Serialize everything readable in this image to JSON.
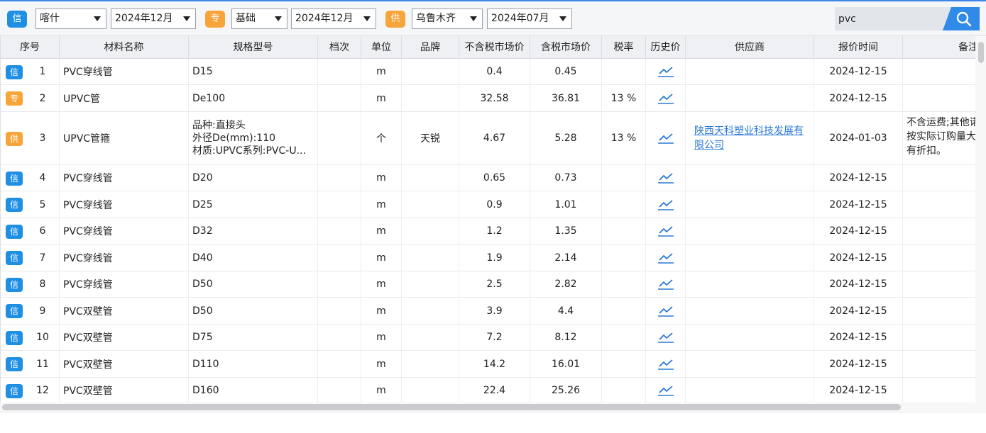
{
  "filters": [
    {
      "badge": "信",
      "badge_color": "#1f8fe3",
      "region": "喀什",
      "date": "2024年12月"
    },
    {
      "badge": "专",
      "badge_color": "#f7a43a",
      "region": "基础",
      "date": "2024年12月"
    },
    {
      "badge": "供",
      "badge_color": "#f7a43a",
      "region": "乌鲁木齐",
      "date": "2024年07月"
    }
  ],
  "search": {
    "value": "pvc"
  },
  "table": {
    "headers": [
      "序号",
      "材料名称",
      "规格型号",
      "档次",
      "单位",
      "品牌",
      "不含税市场价",
      "含税市场价",
      "税率",
      "历史价",
      "供应商",
      "报价时间",
      "备注"
    ],
    "rows": [
      {
        "badge": "信",
        "seq": "1",
        "name": "PVC穿线管",
        "spec": [
          "D15"
        ],
        "grade": "",
        "unit": "m",
        "brand": "",
        "price_ex": "0.4",
        "price_in": "0.45",
        "tax": "",
        "supplier": "",
        "date": "2024-12-15",
        "remark": ""
      },
      {
        "badge": "专",
        "seq": "2",
        "name": "UPVC管",
        "spec": [
          "De100"
        ],
        "grade": "",
        "unit": "m",
        "brand": "",
        "price_ex": "32.58",
        "price_in": "36.81",
        "tax": "13 %",
        "supplier": "",
        "date": "2024-12-15",
        "remark": ""
      },
      {
        "badge": "供",
        "seq": "3",
        "name": "UPVC管箍",
        "spec": [
          "品种:直接头",
          "外径De(mm):110",
          "材质:UPVC系列:PVC-U..."
        ],
        "grade": "",
        "unit": "个",
        "brand": "天锐",
        "price_ex": "4.67",
        "price_in": "5.28",
        "tax": "13 %",
        "supplier": "陕西天科塑业科技发展有限公司",
        "date": "2024-01-03",
        "remark": "不含运费;其他诺体按实际订购量大享有折扣。"
      },
      {
        "badge": "信",
        "seq": "4",
        "name": "PVC穿线管",
        "spec": [
          "D20"
        ],
        "grade": "",
        "unit": "m",
        "brand": "",
        "price_ex": "0.65",
        "price_in": "0.73",
        "tax": "",
        "supplier": "",
        "date": "2024-12-15",
        "remark": ""
      },
      {
        "badge": "信",
        "seq": "5",
        "name": "PVC穿线管",
        "spec": [
          "D25"
        ],
        "grade": "",
        "unit": "m",
        "brand": "",
        "price_ex": "0.9",
        "price_in": "1.01",
        "tax": "",
        "supplier": "",
        "date": "2024-12-15",
        "remark": ""
      },
      {
        "badge": "信",
        "seq": "6",
        "name": "PVC穿线管",
        "spec": [
          "D32"
        ],
        "grade": "",
        "unit": "m",
        "brand": "",
        "price_ex": "1.2",
        "price_in": "1.35",
        "tax": "",
        "supplier": "",
        "date": "2024-12-15",
        "remark": ""
      },
      {
        "badge": "信",
        "seq": "7",
        "name": "PVC穿线管",
        "spec": [
          "D40"
        ],
        "grade": "",
        "unit": "m",
        "brand": "",
        "price_ex": "1.9",
        "price_in": "2.14",
        "tax": "",
        "supplier": "",
        "date": "2024-12-15",
        "remark": ""
      },
      {
        "badge": "信",
        "seq": "8",
        "name": "PVC穿线管",
        "spec": [
          "D50"
        ],
        "grade": "",
        "unit": "m",
        "brand": "",
        "price_ex": "2.5",
        "price_in": "2.82",
        "tax": "",
        "supplier": "",
        "date": "2024-12-15",
        "remark": ""
      },
      {
        "badge": "信",
        "seq": "9",
        "name": "PVC双壁管",
        "spec": [
          "D50"
        ],
        "grade": "",
        "unit": "m",
        "brand": "",
        "price_ex": "3.9",
        "price_in": "4.4",
        "tax": "",
        "supplier": "",
        "date": "2024-12-15",
        "remark": ""
      },
      {
        "badge": "信",
        "seq": "10",
        "name": "PVC双壁管",
        "spec": [
          "D75"
        ],
        "grade": "",
        "unit": "m",
        "brand": "",
        "price_ex": "7.2",
        "price_in": "8.12",
        "tax": "",
        "supplier": "",
        "date": "2024-12-15",
        "remark": ""
      },
      {
        "badge": "信",
        "seq": "11",
        "name": "PVC双壁管",
        "spec": [
          "D110"
        ],
        "grade": "",
        "unit": "m",
        "brand": "",
        "price_ex": "14.2",
        "price_in": "16.01",
        "tax": "",
        "supplier": "",
        "date": "2024-12-15",
        "remark": ""
      },
      {
        "badge": "信",
        "seq": "12",
        "name": "PVC双壁管",
        "spec": [
          "D160"
        ],
        "grade": "",
        "unit": "m",
        "brand": "",
        "price_ex": "22.4",
        "price_in": "25.26",
        "tax": "",
        "supplier": "",
        "date": "2024-12-15",
        "remark": ""
      }
    ]
  },
  "icons": {
    "history": "trend-chart-icon",
    "search": "search-icon"
  },
  "colors": {
    "accent": "#2f8ae8",
    "badge_xin": "#1f8fe3",
    "badge_zhuan_gong": "#f7a43a",
    "link": "#2b78d6",
    "trend_icon": "#2b78d6"
  }
}
